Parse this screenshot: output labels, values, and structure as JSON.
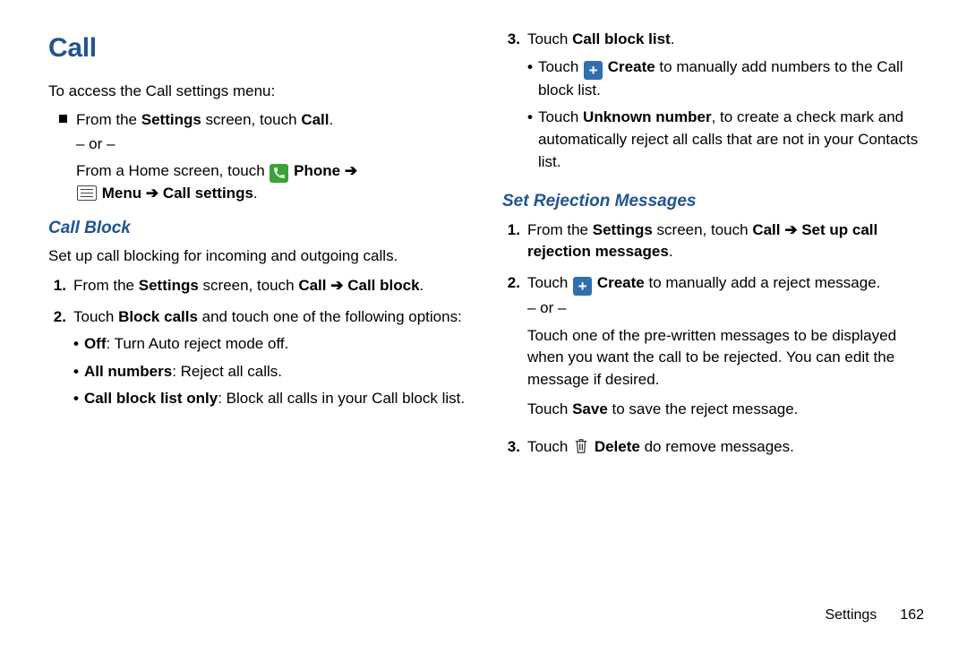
{
  "title": "Call",
  "intro": "To access the Call settings menu:",
  "access": {
    "line1_pre": "From the ",
    "line1_bold": "Settings",
    "line1_mid": " screen, touch ",
    "line1_bold2": "Call",
    "line1_end": ".",
    "or": "– or –",
    "line2_pre": "From a Home screen, touch ",
    "phone_label": "Phone",
    "arrow": " ➔",
    "menu_label": "Menu",
    "callsettings_label": "Call settings",
    "tail": "."
  },
  "callblock": {
    "heading": "Call Block",
    "desc": "Set up call blocking for incoming and outgoing calls.",
    "steps": [
      {
        "pre": "From the ",
        "b1": "Settings",
        "mid1": " screen, touch ",
        "b2": "Call",
        "arrow": " ➔ ",
        "b3": "Call block",
        "end": "."
      },
      {
        "pre": "Touch ",
        "b1": "Block calls",
        "tail": " and touch one of the following options:"
      }
    ],
    "options": [
      {
        "b": "Off",
        "rest": ": Turn Auto reject mode off."
      },
      {
        "b": "All numbers",
        "rest": ": Reject all calls."
      },
      {
        "b": "Call block list only",
        "rest": ": Block all calls in your Call block list."
      }
    ],
    "step3": {
      "num": "3",
      "pre": "Touch ",
      "b": "Call block list",
      "end": "."
    },
    "step3_sub": [
      {
        "pre": "Touch ",
        "icon": "plus",
        "b": "Create",
        "rest": " to manually add numbers to the Call block list."
      },
      {
        "pre": "Touch ",
        "b": "Unknown number",
        "rest": ", to create a check mark and automatically reject all calls that are not in your Contacts list."
      }
    ]
  },
  "rejection": {
    "heading": "Set Rejection Messages",
    "steps": {
      "s1": {
        "num": "1",
        "pre": "From the ",
        "b1": "Settings",
        "mid": " screen, touch ",
        "b2": "Call",
        "arrow": " ➔ ",
        "b3": "Set up call rejection messages",
        "end": "."
      },
      "s2": {
        "num": "2",
        "pre": "Touch ",
        "icon": "plus",
        "b": "Create",
        "rest": " to manually add a reject message.",
        "or": "– or –",
        "para2": "Touch one of the pre-written messages to be displayed when you want the call to be rejected. You can edit the message if desired.",
        "para3_pre": "Touch ",
        "para3_b": "Save",
        "para3_rest": " to save the reject message."
      },
      "s3": {
        "num": "3",
        "pre": "Touch ",
        "icon": "trash",
        "b": "Delete",
        "rest": " do remove messages."
      }
    }
  },
  "footer": {
    "section": "Settings",
    "page": "162"
  }
}
